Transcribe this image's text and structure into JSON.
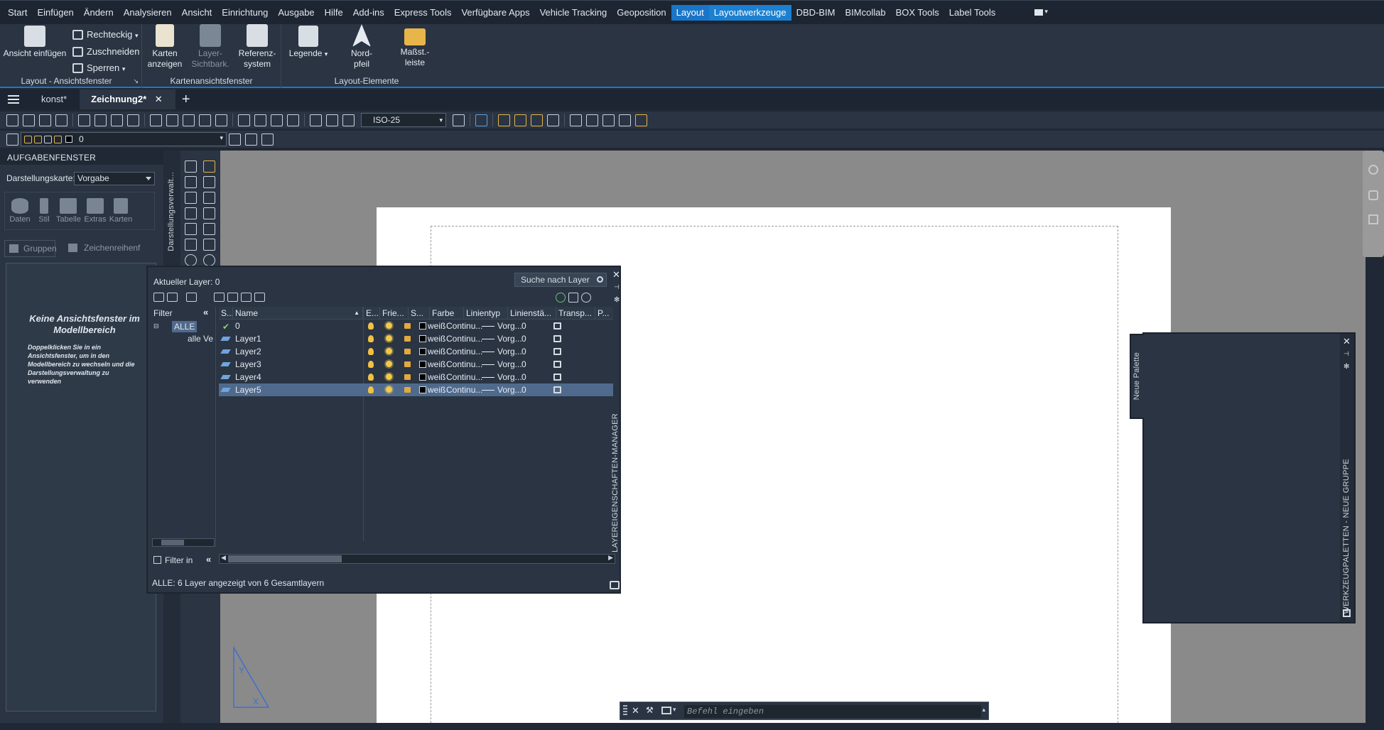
{
  "menu": {
    "items": [
      "Start",
      "Einfügen",
      "Ändern",
      "Analysieren",
      "Ansicht",
      "Einrichtung",
      "Ausgabe",
      "Hilfe",
      "Add-ins",
      "Express Tools",
      "Verfügbare Apps",
      "Vehicle Tracking",
      "Geoposition",
      "Layout",
      "Layoutwerkzeuge",
      "DBD-BIM",
      "BIMcollab",
      "BOX Tools",
      "Label Tools"
    ],
    "active": "Layout",
    "contextual": "Layoutwerkzeuge"
  },
  "ribbon": {
    "panel1": {
      "label": "Layout - Ansichtsfenster",
      "insert_view": "Ansicht einfügen",
      "rect": "Rechteckig",
      "clip": "Zuschneiden",
      "lock": "Sperren"
    },
    "panel2": {
      "label": "Kartenansichtsfenster",
      "maps_1": "Karten",
      "maps_2": "anzeigen",
      "layervis_1": "Layer-",
      "layervis_2": "Sichtbark.",
      "refsys_1": "Referenz-",
      "refsys_2": "system"
    },
    "panel3": {
      "label": "Layout-Elemente",
      "legend": "Legende",
      "north_1": "Nord-",
      "north_2": "pfeil",
      "scale_1": "Maßst.-",
      "scale_2": "leiste"
    }
  },
  "tabs": {
    "items": [
      "konst*",
      "Zeichnung2*"
    ],
    "active": "Zeichnung2*"
  },
  "toolbar": {
    "dimstyle": "ISO-25",
    "layer": "0"
  },
  "taskpane": {
    "title": "AUFGABENFENSTER",
    "map_label": "Darstellungskarte:",
    "map_value": "Vorgabe",
    "icons": [
      "Daten",
      "Stil",
      "Tabelle",
      "Extras",
      "Karten"
    ],
    "groups": "Gruppen",
    "draworder": "Zeichenreihenf",
    "empty_title": "Keine Ansichtsfenster im Modellbereich",
    "empty_text": "Doppelklicken Sie in ein Ansichtsfenster, um in den Modellbereich zu wechseln und die Darstellungsverwaltung zu verwenden",
    "side_tab": "Darstellungsverwalt..."
  },
  "layermanager": {
    "current": "Aktueller Layer: 0",
    "search_placeholder": "Suche nach Layer",
    "filter": "Filter",
    "tree_all": "ALLE",
    "tree_used": "alle Ve",
    "filter_invert": "Filter in",
    "status": "ALLE: 6 Layer angezeigt von 6 Gesamtlayern",
    "side_title": "LAYEREIGENSCHAFTEN-MANAGER",
    "columns": [
      "S...",
      "Name",
      "E...",
      "Frie...",
      "S...",
      "Farbe",
      "Linientyp",
      "Linienstä...",
      "Transp...",
      "P..."
    ],
    "rows": [
      {
        "name": "0",
        "color": "weiß",
        "linetype": "Continu...",
        "lineweight": "Vorg...",
        "transp": "0",
        "current": true
      },
      {
        "name": "Layer1",
        "color": "weiß",
        "linetype": "Continu...",
        "lineweight": "Vorg...",
        "transp": "0"
      },
      {
        "name": "Layer2",
        "color": "weiß",
        "linetype": "Continu...",
        "lineweight": "Vorg...",
        "transp": "0"
      },
      {
        "name": "Layer3",
        "color": "weiß",
        "linetype": "Continu...",
        "lineweight": "Vorg...",
        "transp": "0"
      },
      {
        "name": "Layer4",
        "color": "weiß",
        "linetype": "Continu...",
        "lineweight": "Vorg...",
        "transp": "0"
      },
      {
        "name": "Layer5",
        "color": "weiß",
        "linetype": "Continu...",
        "lineweight": "Vorg...",
        "transp": "0",
        "selected": true
      }
    ]
  },
  "palette": {
    "tab": "Neue Palette",
    "side_title": "WERKZEUGPALETTEN - NEUE GRUPPE"
  },
  "commandline": {
    "placeholder": "Befehl eingeben"
  },
  "colors": {
    "accent": "#1975c8",
    "selection": "#4f6a8c",
    "bulb": "#f2c043"
  }
}
